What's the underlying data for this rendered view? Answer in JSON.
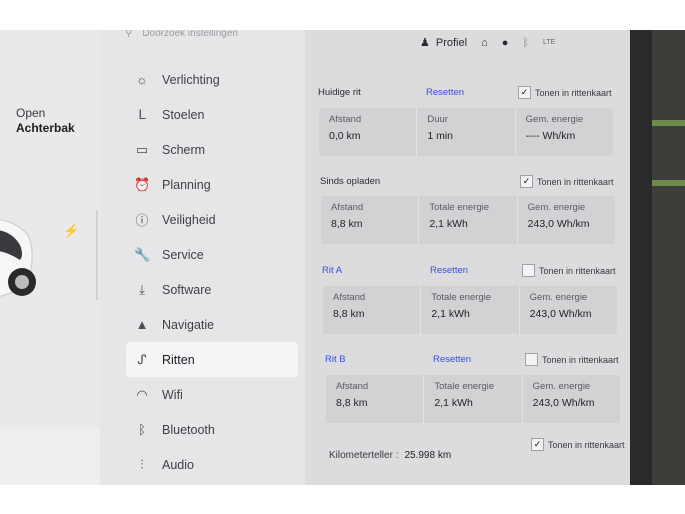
{
  "search": {
    "placeholder": "Doorzoek instellingen"
  },
  "topbar": {
    "profile_label": "Profiel",
    "signal": "LTE"
  },
  "left_panel": {
    "open_line1": "Open",
    "open_line2": "Achterbak"
  },
  "nav": [
    {
      "label": "Verlichting",
      "icon": "sun-icon",
      "glyph": "☼"
    },
    {
      "label": "Stoelen",
      "icon": "seat-icon",
      "glyph": "ᒪ"
    },
    {
      "label": "Scherm",
      "icon": "screen-icon",
      "glyph": "▭"
    },
    {
      "label": "Planning",
      "icon": "clock-icon",
      "glyph": "⏰"
    },
    {
      "label": "Veiligheid",
      "icon": "safety-icon",
      "glyph": "ⓘ"
    },
    {
      "label": "Service",
      "icon": "wrench-icon",
      "glyph": "🔧"
    },
    {
      "label": "Software",
      "icon": "download-icon",
      "glyph": "⤓"
    },
    {
      "label": "Navigatie",
      "icon": "navigation-icon",
      "glyph": "▲"
    },
    {
      "label": "Ritten",
      "icon": "trips-icon",
      "glyph": "ᔑ",
      "active": true
    },
    {
      "label": "Wifi",
      "icon": "wifi-icon",
      "glyph": "◠"
    },
    {
      "label": "Bluetooth",
      "icon": "bluetooth-icon",
      "glyph": "ᛒ"
    },
    {
      "label": "Audio",
      "icon": "audio-icon",
      "glyph": "⫶"
    }
  ],
  "sections": [
    {
      "title": "Huidige rit",
      "reset": "Resetten",
      "checkbox_label": "Tonen in rittenkaart",
      "checked": true,
      "cells": [
        {
          "label": "Afstand",
          "value": "0,0 km"
        },
        {
          "label": "Duur",
          "value": "1 min"
        },
        {
          "label": "Gem. energie",
          "value": "---- Wh/km"
        }
      ]
    },
    {
      "title": "Sinds opladen",
      "reset": "",
      "checkbox_label": "Tonen in rittenkaart",
      "checked": true,
      "cells": [
        {
          "label": "Afstand",
          "value": "8,8 km"
        },
        {
          "label": "Totale energie",
          "value": "2,1 kWh"
        },
        {
          "label": "Gem. energie",
          "value": "243,0 Wh/km"
        }
      ]
    },
    {
      "title": "Rit A",
      "reset": "Resetten",
      "checkbox_label": "Tonen in rittenkaart",
      "checked": false,
      "cells": [
        {
          "label": "Afstand",
          "value": "8,8 km"
        },
        {
          "label": "Totale energie",
          "value": "2,1 kWh"
        },
        {
          "label": "Gem. energie",
          "value": "243,0 Wh/km"
        }
      ]
    },
    {
      "title": "Rit B",
      "reset": "Resetten",
      "checkbox_label": "Tonen in rittenkaart",
      "checked": false,
      "cells": [
        {
          "label": "Afstand",
          "value": "8,8 km"
        },
        {
          "label": "Totale energie",
          "value": "2,1 kWh"
        },
        {
          "label": "Gem. energie",
          "value": "243,0 Wh/km"
        }
      ]
    }
  ],
  "odometer": {
    "label": "Kilometerteller :",
    "value": "25.998 km",
    "checkbox_label": "Tonen in rittenkaart",
    "checked": true
  },
  "colors": {
    "accent": "#3b4fd6",
    "panel": "#dcdcdf",
    "card": "#d2d2d5"
  }
}
